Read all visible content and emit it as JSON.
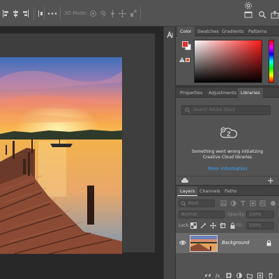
{
  "options_bar": {
    "mode3d_label": "3D Mode:"
  },
  "color_panel": {
    "tabs": [
      "Color",
      "Swatches",
      "Gradients",
      "Patterns"
    ],
    "active_tab": "Color",
    "foreground_color": "#e03030",
    "background_color": "#ffffff"
  },
  "libraries_panel": {
    "tabs": [
      "Properties",
      "Adjustments",
      "Libraries"
    ],
    "active_tab": "Libraries",
    "search_placeholder": "Search Adobe Stock",
    "message_line1": "Something went wrong initializing",
    "message_line2": "Creative Cloud libraries",
    "link": "More information"
  },
  "layers_panel": {
    "tabs": [
      "Layers",
      "Channels",
      "Paths"
    ],
    "active_tab": "Layers",
    "filter_kind": "Kind",
    "blend_mode": "Normal",
    "opacity_label": "Opacity:",
    "opacity_value": "100%",
    "lock_label": "Lock:",
    "fill_label": "Fill:",
    "fill_value": "100%",
    "layers": [
      {
        "name": "Background",
        "visible": true,
        "locked": true
      }
    ]
  },
  "colors": {
    "accent_link": "#33a2ff",
    "panel_bg": "#535353",
    "selected_layer": "#6a6a6a"
  }
}
